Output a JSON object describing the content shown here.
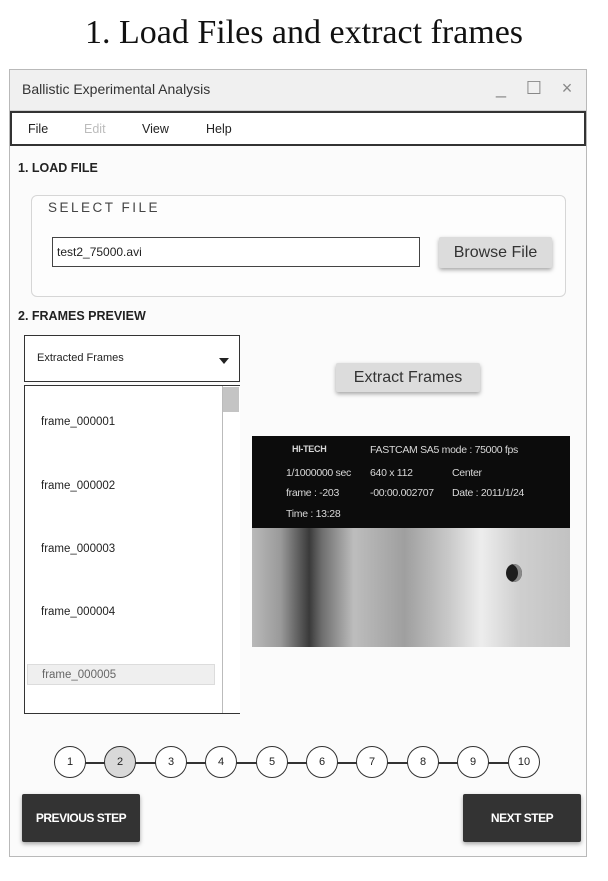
{
  "caption": "1. Load Files and extract frames",
  "window": {
    "title": "Ballistic Experimental Analysis",
    "controls": {
      "minimize": "_",
      "maximize": "☐",
      "close": "×"
    }
  },
  "menu": {
    "file": "File",
    "edit": "Edit",
    "view": "View",
    "help": "Help"
  },
  "load_file": {
    "section_title": "1. LOAD FILE",
    "group_label": "SELECT FILE",
    "path_value": "test2_75000.avi",
    "browse_label": "Browse File"
  },
  "frames_preview": {
    "section_title": "2. FRAMES PREVIEW",
    "dropdown_value": "Extracted Frames",
    "extract_label": "Extract Frames",
    "frames": [
      "frame_000001",
      "frame_000002",
      "frame_000003",
      "frame_000004",
      "frame_000005"
    ],
    "selected_frame": "frame_000005"
  },
  "preview_overlay": {
    "brand": "HI-TECH",
    "camera": "FASTCAM SA5 mode : 75000 fps",
    "shutter": "1/1000000 sec",
    "resolution": "640 x 112",
    "position": "Center",
    "frame": "frame : -203",
    "elapsed": "-00:00.002707",
    "date": "Date : 2011/1/24",
    "time": "Time : 13:28"
  },
  "steps": {
    "items": [
      "1",
      "2",
      "3",
      "4",
      "5",
      "6",
      "7",
      "8",
      "9",
      "10"
    ],
    "active": "2"
  },
  "navigation": {
    "previous": "PREVIOUS STEP",
    "next": "NEXT STEP"
  }
}
